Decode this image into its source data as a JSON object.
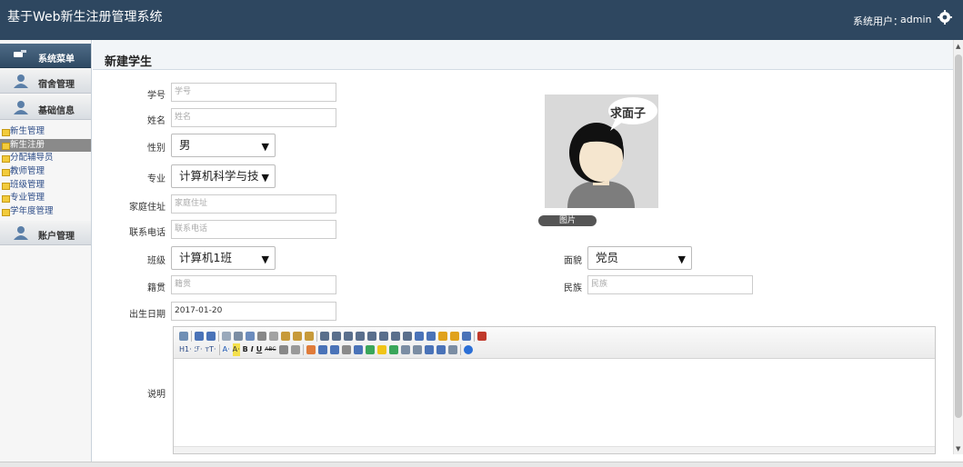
{
  "header": {
    "title": "基于Web新生注册管理系统",
    "user_label": "系统用户：",
    "user_name": "admin",
    "settings_icon": "gear-icon"
  },
  "sidebar": {
    "menu_title": "系统菜单",
    "sections": [
      {
        "label": "宿舍管理",
        "icon": "user-icon"
      },
      {
        "label": "基础信息",
        "icon": "user-icon"
      },
      {
        "label": "账户管理",
        "icon": "user-icon"
      }
    ],
    "sub_items": [
      "新生管理",
      "新生注册",
      "分配辅导员",
      "教师管理",
      "班级管理",
      "专业管理",
      "学年度管理"
    ],
    "active_sub_item": "新生注册"
  },
  "page": {
    "title": "新建学生"
  },
  "form": {
    "student_id": {
      "label": "学号",
      "placeholder": "学号"
    },
    "name": {
      "label": "姓名",
      "placeholder": "姓名"
    },
    "gender": {
      "label": "性别",
      "value": "男"
    },
    "major": {
      "label": "专业",
      "value": "计算机科学与技"
    },
    "address": {
      "label": "家庭住址",
      "placeholder": "家庭住址"
    },
    "phone": {
      "label": "联系电话",
      "placeholder": "联系电话"
    },
    "class": {
      "label": "班级",
      "value": "计算机1班"
    },
    "politics": {
      "label": "面貌",
      "value": "党员"
    },
    "hometown": {
      "label": "籍贯",
      "placeholder": "籍贯"
    },
    "ethnicity": {
      "label": "民族",
      "placeholder": "民族"
    },
    "birthdate": {
      "label": "出生日期",
      "value": "2017-01-20"
    },
    "description": {
      "label": "说明"
    }
  },
  "photo": {
    "caption": "求面子",
    "button_label": "图片"
  },
  "editor": {
    "toolbar_text": {
      "heading": "H1·",
      "font_family": "ℱ·",
      "font_size": "тT·",
      "text_color": "A·",
      "bg_color": "A·",
      "bold": "B",
      "italic": "I",
      "underline": "U",
      "strikethrough": "ABC"
    }
  },
  "colors": {
    "header_bg": "#2e4760",
    "sidebar_active": "#8a8a8a",
    "sub_item_marker": "#f2cb3c"
  }
}
